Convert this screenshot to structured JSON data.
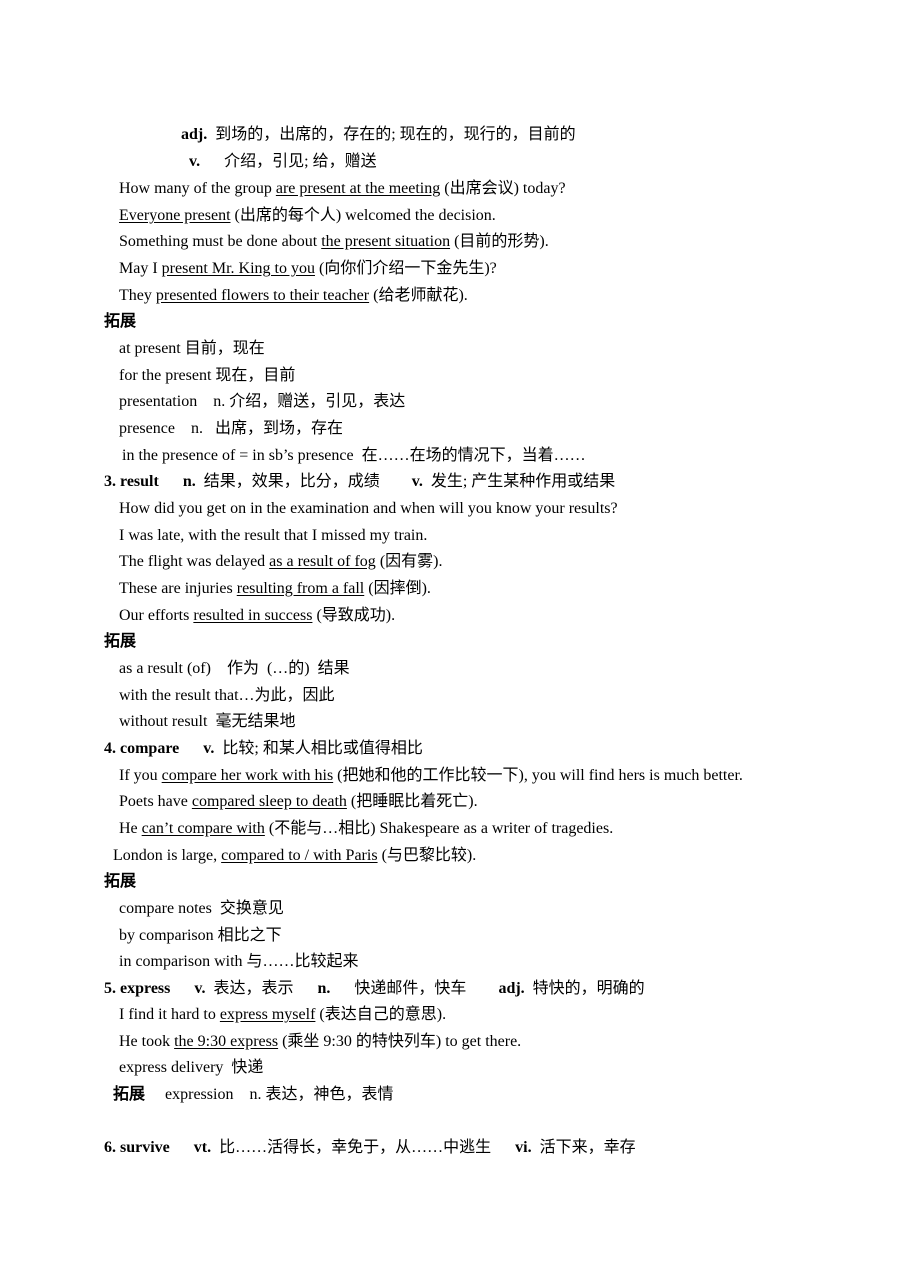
{
  "present": {
    "adj_label": "adj.",
    "adj_meaning": "到场的，出席的，存在的; 现在的，现行的，目前的",
    "v_label": "v.",
    "v_meaning": "介绍，引见; 给，赠送",
    "examples": [
      {
        "pre": "How many of the group ",
        "u": "are present at the meeting",
        "post": " (出席会议) today?"
      },
      {
        "pre": "",
        "u": "Everyone present",
        "post": " (出席的每个人) welcomed the decision."
      },
      {
        "pre": "Something must be done about ",
        "u": "the present situation",
        "post": " (目前的形势)."
      },
      {
        "pre": "May I ",
        "u": "present Mr. King to you",
        "post": " (向你们介绍一下金先生)?"
      },
      {
        "pre": "They ",
        "u": "presented flowers to their teacher",
        "post": " (给老师献花)."
      }
    ],
    "extension_title": "拓展",
    "extension": [
      "at present 目前，现在",
      "for the present 现在，目前",
      "presentation    n. 介绍，赠送，引见，表达",
      "presence    n.   出席，到场，存在",
      "in the presence of = in sb’s presence  在……在场的情况下，当着……"
    ]
  },
  "result": {
    "heading": "3. result",
    "n_label": "n.",
    "n_meaning": "结果，效果，比分，成绩",
    "v_label": "v.",
    "v_meaning": "发生; 产生某种作用或结果",
    "examples": [
      {
        "pre": "How did you get on in the examination and when will you know your results?",
        "u": "",
        "post": ""
      },
      {
        "pre": "I was late, with the result that I missed my train.",
        "u": "",
        "post": ""
      },
      {
        "pre": "The flight was delayed ",
        "u": "as a result of fog",
        "post": " (因有雾)."
      },
      {
        "pre": "These are injuries ",
        "u": "resulting from a fall",
        "post": " (因摔倒)."
      },
      {
        "pre": "Our efforts ",
        "u": "resulted in success",
        "post": " (导致成功)."
      }
    ],
    "extension_title": "拓展",
    "extension": [
      "as a result (of)    作为  (…的)  结果",
      "with the result that…为此，因此",
      "without result  毫无结果地"
    ]
  },
  "compare": {
    "heading": "4. compare",
    "v_label": "v.",
    "v_meaning": "比较; 和某人相比或值得相比",
    "examples": [
      {
        "pre": "If you ",
        "u": "compare her work with his",
        "post": " (把她和他的工作比较一下), you will find hers is much better."
      },
      {
        "pre": "Poets have ",
        "u": "compared sleep to death",
        "post": " (把睡眠比着死亡)."
      },
      {
        "pre": "He ",
        "u": "can’t compare with",
        "post": " (不能与…相比) Shakespeare as a writer of tragedies."
      },
      {
        "pre": "London is large, ",
        "u": "compared to / with Paris",
        "post": " (与巴黎比较)."
      }
    ],
    "extension_title": "拓展",
    "extension": [
      "compare notes  交换意见",
      "by comparison 相比之下",
      "in comparison with 与……比较起来"
    ]
  },
  "express": {
    "heading": "5. express",
    "v_label": "v.",
    "v_meaning": "表达，表示",
    "n_label": "n.",
    "n_meaning": "快递邮件，快车",
    "adj_label": "adj.",
    "adj_meaning": "特快的，明确的",
    "examples": [
      {
        "pre": "I find it hard to ",
        "u": "express myself",
        "post": " (表达自己的意思)."
      },
      {
        "pre": "He took ",
        "u": "the 9:30 express",
        "post": " (乘坐 9:30 的特快列车) to get there."
      },
      {
        "pre": "express delivery  快递",
        "u": "",
        "post": ""
      }
    ],
    "extension_title": "拓展",
    "extension_inline": "expression    n. 表达，神色，表情"
  },
  "survive": {
    "heading": "6. survive",
    "vt_label": "vt.",
    "vt_meaning": "比……活得长，幸免于，从……中逃生",
    "vi_label": "vi.",
    "vi_meaning": "活下来，幸存"
  }
}
